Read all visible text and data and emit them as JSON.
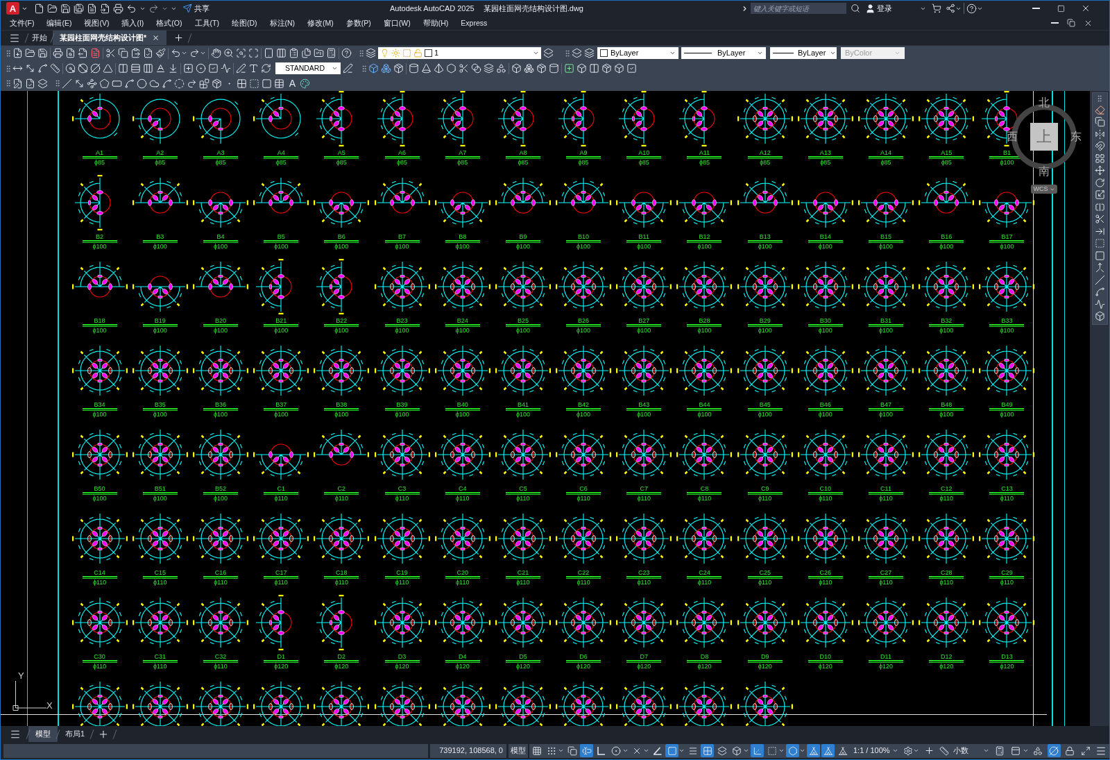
{
  "title_bar": {
    "logo": "A",
    "share": "共享",
    "app_name": "Autodesk AutoCAD 2025",
    "file_name": "某园柱面网壳结构设计图.dwg",
    "search": {
      "placeholder": "键入关键字或短语"
    },
    "sign_in": "登录"
  },
  "menu_bar": {
    "items": [
      "文件(F)",
      "编辑(E)",
      "视图(V)",
      "插入(I)",
      "格式(O)",
      "工具(T)",
      "绘图(D)",
      "标注(N)",
      "修改(M)",
      "参数(P)",
      "窗口(W)",
      "帮助(H)",
      "Express"
    ]
  },
  "file_tabs": [
    {
      "label": "开始",
      "selected": false,
      "closable": false
    },
    {
      "label": "某园柱面网壳结构设计图*",
      "selected": true,
      "closable": true
    }
  ],
  "toolbars": {
    "layer": "1",
    "color_control": "ByLayer",
    "linetype": "ByLayer",
    "lineweight": "ByLayer",
    "plot_style": {
      "label": "ByColor",
      "disabled": true
    },
    "text_style": "STANDARD",
    "text_tool": "A"
  },
  "drawing": {
    "rows": [
      [
        {
          "id": "A1",
          "size": "ϕ85",
          "kind": "quarter-up"
        },
        {
          "id": "A2",
          "size": "ϕ85",
          "kind": "quarter-down"
        },
        {
          "id": "A3",
          "size": "ϕ85",
          "kind": "quarter-down"
        },
        {
          "id": "A4",
          "size": "ϕ85",
          "kind": "quarter-up"
        },
        {
          "id": "A5",
          "size": "ϕ85",
          "kind": "half-left"
        },
        {
          "id": "A6",
          "size": "ϕ85",
          "kind": "half-left"
        },
        {
          "id": "A7",
          "size": "ϕ85",
          "kind": "half-left"
        },
        {
          "id": "A8",
          "size": "ϕ85",
          "kind": "half-left"
        },
        {
          "id": "A9",
          "size": "ϕ85",
          "kind": "half-left"
        },
        {
          "id": "A10",
          "size": "ϕ85",
          "kind": "half-left"
        },
        {
          "id": "A11",
          "size": "ϕ85",
          "kind": "half-left"
        },
        {
          "id": "A12",
          "size": "ϕ85",
          "kind": "full"
        },
        {
          "id": "A13",
          "size": "ϕ85",
          "kind": "full"
        },
        {
          "id": "A14",
          "size": "ϕ85",
          "kind": "full"
        },
        {
          "id": "A15",
          "size": "ϕ85",
          "kind": "full"
        },
        {
          "id": "B1",
          "size": "ϕ100",
          "kind": "half-left"
        }
      ],
      [
        {
          "id": "B2",
          "size": "ϕ100",
          "kind": "half-left"
        },
        {
          "id": "B3",
          "size": "ϕ100",
          "kind": "half-up"
        },
        {
          "id": "B4",
          "size": "ϕ100",
          "kind": "half-down"
        },
        {
          "id": "B5",
          "size": "ϕ100",
          "kind": "half-up"
        },
        {
          "id": "B6",
          "size": "ϕ100",
          "kind": "half-down"
        },
        {
          "id": "B7",
          "size": "ϕ100",
          "kind": "half-up"
        },
        {
          "id": "B8",
          "size": "ϕ100",
          "kind": "half-down"
        },
        {
          "id": "B9",
          "size": "ϕ100",
          "kind": "half-up"
        },
        {
          "id": "B10",
          "size": "ϕ100",
          "kind": "half-up"
        },
        {
          "id": "B11",
          "size": "ϕ100",
          "kind": "half-down"
        },
        {
          "id": "B12",
          "size": "ϕ100",
          "kind": "half-down"
        },
        {
          "id": "B13",
          "size": "ϕ100",
          "kind": "half-up"
        },
        {
          "id": "B14",
          "size": "ϕ100",
          "kind": "half-down"
        },
        {
          "id": "B15",
          "size": "ϕ100",
          "kind": "half-down"
        },
        {
          "id": "B16",
          "size": "ϕ100",
          "kind": "half-up"
        },
        {
          "id": "B17",
          "size": "ϕ100",
          "kind": "half-down"
        }
      ],
      [
        {
          "id": "B18",
          "size": "ϕ100",
          "kind": "half-up"
        },
        {
          "id": "B19",
          "size": "ϕ100",
          "kind": "half-down"
        },
        {
          "id": "B20",
          "size": "ϕ100",
          "kind": "half-up"
        },
        {
          "id": "B21",
          "size": "ϕ100",
          "kind": "half-left"
        },
        {
          "id": "B22",
          "size": "ϕ100",
          "kind": "half-left"
        },
        {
          "id": "B23",
          "size": "ϕ100",
          "kind": "full"
        },
        {
          "id": "B24",
          "size": "ϕ100",
          "kind": "full"
        },
        {
          "id": "B25",
          "size": "ϕ100",
          "kind": "full"
        },
        {
          "id": "B26",
          "size": "ϕ100",
          "kind": "full"
        },
        {
          "id": "B27",
          "size": "ϕ100",
          "kind": "full"
        },
        {
          "id": "B28",
          "size": "ϕ100",
          "kind": "full"
        },
        {
          "id": "B29",
          "size": "ϕ100",
          "kind": "full"
        },
        {
          "id": "B30",
          "size": "ϕ100",
          "kind": "full"
        },
        {
          "id": "B31",
          "size": "ϕ100",
          "kind": "full"
        },
        {
          "id": "B32",
          "size": "ϕ100",
          "kind": "full"
        },
        {
          "id": "B33",
          "size": "ϕ100",
          "kind": "full"
        }
      ],
      [
        {
          "id": "B34",
          "size": "ϕ100",
          "kind": "full"
        },
        {
          "id": "B35",
          "size": "ϕ100",
          "kind": "full"
        },
        {
          "id": "B36",
          "size": "ϕ100",
          "kind": "full"
        },
        {
          "id": "B37",
          "size": "ϕ100",
          "kind": "full"
        },
        {
          "id": "B38",
          "size": "ϕ100",
          "kind": "full"
        },
        {
          "id": "B39",
          "size": "ϕ100",
          "kind": "full"
        },
        {
          "id": "B40",
          "size": "ϕ100",
          "kind": "full"
        },
        {
          "id": "B41",
          "size": "ϕ100",
          "kind": "full"
        },
        {
          "id": "B42",
          "size": "ϕ100",
          "kind": "full"
        },
        {
          "id": "B43",
          "size": "ϕ100",
          "kind": "full"
        },
        {
          "id": "B44",
          "size": "ϕ100",
          "kind": "full"
        },
        {
          "id": "B45",
          "size": "ϕ100",
          "kind": "full"
        },
        {
          "id": "B46",
          "size": "ϕ100",
          "kind": "full"
        },
        {
          "id": "B47",
          "size": "ϕ100",
          "kind": "full"
        },
        {
          "id": "B48",
          "size": "ϕ100",
          "kind": "full"
        },
        {
          "id": "B49",
          "size": "ϕ100",
          "kind": "full"
        }
      ],
      [
        {
          "id": "B50",
          "size": "ϕ100",
          "kind": "full"
        },
        {
          "id": "B51",
          "size": "ϕ100",
          "kind": "full"
        },
        {
          "id": "B52",
          "size": "ϕ100",
          "kind": "full"
        },
        {
          "id": "C1",
          "size": "ϕ110",
          "kind": "half-down"
        },
        {
          "id": "C2",
          "size": "ϕ110",
          "kind": "half-up"
        },
        {
          "id": "C3",
          "size": "ϕ110",
          "kind": "full"
        },
        {
          "id": "C4",
          "size": "ϕ110",
          "kind": "full"
        },
        {
          "id": "C5",
          "size": "ϕ110",
          "kind": "full"
        },
        {
          "id": "C6",
          "size": "ϕ110",
          "kind": "full"
        },
        {
          "id": "C7",
          "size": "ϕ110",
          "kind": "full"
        },
        {
          "id": "C8",
          "size": "ϕ110",
          "kind": "full"
        },
        {
          "id": "C9",
          "size": "ϕ110",
          "kind": "full"
        },
        {
          "id": "C10",
          "size": "ϕ110",
          "kind": "full"
        },
        {
          "id": "C11",
          "size": "ϕ110",
          "kind": "full"
        },
        {
          "id": "C12",
          "size": "ϕ110",
          "kind": "full"
        },
        {
          "id": "C13",
          "size": "ϕ110",
          "kind": "full"
        }
      ],
      [
        {
          "id": "C14",
          "size": "ϕ110",
          "kind": "full"
        },
        {
          "id": "C15",
          "size": "ϕ110",
          "kind": "full"
        },
        {
          "id": "C16",
          "size": "ϕ110",
          "kind": "full"
        },
        {
          "id": "C17",
          "size": "ϕ110",
          "kind": "full"
        },
        {
          "id": "C18",
          "size": "ϕ110",
          "kind": "full"
        },
        {
          "id": "C19",
          "size": "ϕ110",
          "kind": "full"
        },
        {
          "id": "C20",
          "size": "ϕ110",
          "kind": "full"
        },
        {
          "id": "C21",
          "size": "ϕ110",
          "kind": "full"
        },
        {
          "id": "C22",
          "size": "ϕ110",
          "kind": "full"
        },
        {
          "id": "C23",
          "size": "ϕ110",
          "kind": "full"
        },
        {
          "id": "C24",
          "size": "ϕ110",
          "kind": "full"
        },
        {
          "id": "C25",
          "size": "ϕ110",
          "kind": "full"
        },
        {
          "id": "C26",
          "size": "ϕ110",
          "kind": "full"
        },
        {
          "id": "C27",
          "size": "ϕ110",
          "kind": "full"
        },
        {
          "id": "C28",
          "size": "ϕ110",
          "kind": "full"
        },
        {
          "id": "C29",
          "size": "ϕ110",
          "kind": "full"
        }
      ],
      [
        {
          "id": "C30",
          "size": "ϕ110",
          "kind": "full"
        },
        {
          "id": "C31",
          "size": "ϕ110",
          "kind": "full"
        },
        {
          "id": "C32",
          "size": "ϕ110",
          "kind": "full"
        },
        {
          "id": "D1",
          "size": "ϕ120",
          "kind": "half-left"
        },
        {
          "id": "D2",
          "size": "ϕ120",
          "kind": "half-left"
        },
        {
          "id": "D3",
          "size": "ϕ120",
          "kind": "full"
        },
        {
          "id": "D4",
          "size": "ϕ120",
          "kind": "full"
        },
        {
          "id": "D5",
          "size": "ϕ120",
          "kind": "full"
        },
        {
          "id": "D6",
          "size": "ϕ120",
          "kind": "full"
        },
        {
          "id": "D7",
          "size": "ϕ120",
          "kind": "full"
        },
        {
          "id": "D8",
          "size": "ϕ120",
          "kind": "full"
        },
        {
          "id": "D9",
          "size": "ϕ120",
          "kind": "full"
        },
        {
          "id": "D10",
          "size": "ϕ120",
          "kind": "full"
        },
        {
          "id": "D11",
          "size": "ϕ120",
          "kind": "full"
        },
        {
          "id": "D12",
          "size": "ϕ120",
          "kind": "full"
        },
        {
          "id": "D13",
          "size": "ϕ120",
          "kind": "full"
        }
      ]
    ],
    "cut_row": [
      {
        "kind": "full"
      },
      {
        "kind": "full"
      },
      {
        "kind": "full"
      },
      {
        "kind": "full"
      },
      {
        "kind": "full"
      },
      {
        "kind": "full"
      },
      {
        "kind": "full"
      },
      {
        "kind": "full"
      },
      {
        "kind": "full"
      },
      {
        "kind": "full"
      },
      {
        "kind": "full"
      },
      {
        "kind": "full"
      }
    ]
  },
  "view_cube": {
    "north": "北",
    "west": "西",
    "face": "上",
    "east": "东",
    "south": "南",
    "ucs_menu": "WCS"
  },
  "ucs_icon": {
    "y": "Y",
    "x": "X"
  },
  "layout_tabs": [
    {
      "label": "模型",
      "selected": true
    },
    {
      "label": "布局1",
      "selected": false
    }
  ],
  "status_bar": {
    "coordinates": "739192, 108568, 0",
    "space": "模型",
    "toggles": [
      {
        "kind": "grid",
        "on": false
      },
      {
        "kind": "snap",
        "on": false
      },
      {
        "kind": "infer",
        "on": false
      },
      {
        "kind": "dynamic-input",
        "on": true
      },
      {
        "kind": "ortho",
        "on": false
      },
      {
        "kind": "polar",
        "on": false
      },
      {
        "kind": "tracking",
        "on": false
      },
      {
        "kind": "angle",
        "on": false
      },
      {
        "kind": "object-snap",
        "on": true
      },
      {
        "kind": "lineweight",
        "on": false
      },
      {
        "kind": "transparency",
        "on": true
      },
      {
        "kind": "selection-cycling",
        "on": false
      },
      {
        "kind": "osnap-3d",
        "on": false
      },
      {
        "kind": "dynamic-ucs",
        "on": true
      },
      {
        "kind": "selection-filter",
        "on": false
      },
      {
        "kind": "gizmo",
        "on": true
      },
      {
        "kind": "annotation-visibility",
        "on": true
      },
      {
        "kind": "auto-scale",
        "on": true
      },
      {
        "kind": "annotation-scale",
        "on": false
      }
    ],
    "annotation_scale": "1:1 / 100%",
    "units": "小数",
    "tools": [
      {
        "kind": "properties",
        "on": false
      },
      {
        "kind": "lock-ui",
        "on": false
      },
      {
        "kind": "isolate",
        "on": false
      },
      {
        "kind": "hardware-acceleration",
        "on": true
      },
      {
        "kind": "clean-screen",
        "on": false
      },
      {
        "kind": "full-screen",
        "on": false
      }
    ]
  }
}
